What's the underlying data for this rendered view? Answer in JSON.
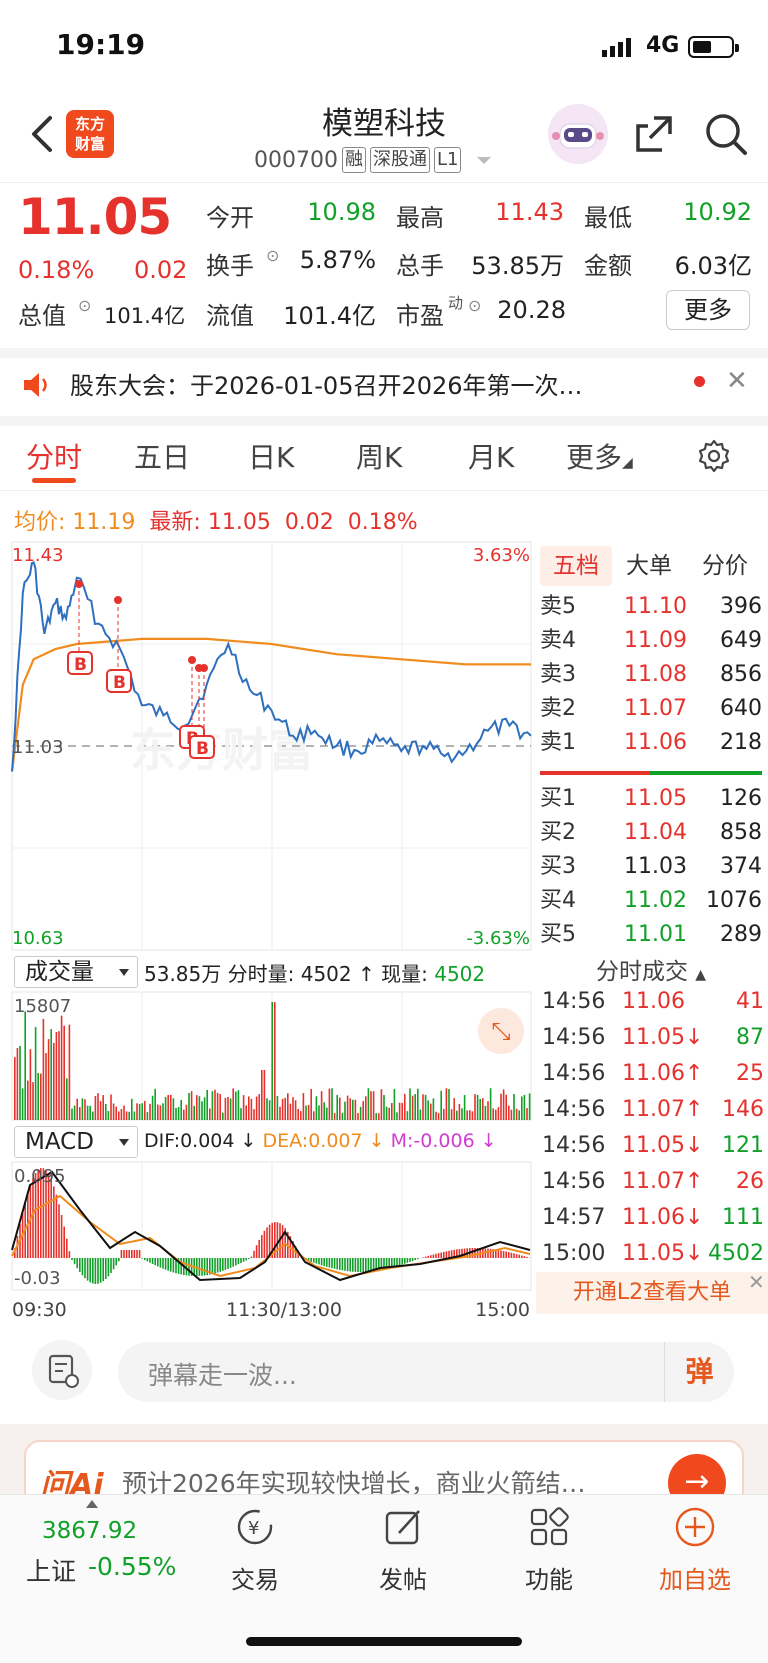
{
  "status_bar": {
    "time": "19:19",
    "network": "4G"
  },
  "header": {
    "stock_name": "模塑科技",
    "stock_code": "000700",
    "tags": [
      "融",
      "深股通",
      "L1"
    ],
    "logo_text": [
      "东方",
      "财富"
    ]
  },
  "quote": {
    "last_price": "11.05",
    "change_pct": "0.18%",
    "change_amt": "0.02",
    "open_label": "今开",
    "open": "10.98",
    "high_label": "最高",
    "high": "11.43",
    "low_label": "最低",
    "low": "10.92",
    "turnover_label": "换手",
    "turnover": "5.87%",
    "volume_label": "总手",
    "volume": "53.85万",
    "amount_label": "金额",
    "amount": "6.03亿",
    "mktcap_label": "总值",
    "mktcap": "101.4亿",
    "float_label": "流值",
    "float": "101.4亿",
    "pe_label": "市盈",
    "pe_sup": "动",
    "pe": "20.28",
    "more_label": "更多"
  },
  "announcement": {
    "text": "股东大会：于2026-01-05召开2026年第一次…"
  },
  "tabs": [
    "分时",
    "五日",
    "日K",
    "周K",
    "月K",
    "更多"
  ],
  "avg_line": {
    "avg_label": "均价:",
    "avg": "11.19",
    "latest_label": "最新:",
    "latest": "11.05",
    "chg": "0.02",
    "pct": "0.18%"
  },
  "chart_axes": {
    "y_top": "11.43",
    "y_bottom": "10.63",
    "y_mid": "11.03",
    "pct_top": "3.63%",
    "pct_bottom": "-3.63%",
    "x_start": "09:30",
    "x_mid": "11:30/13:00",
    "x_end": "15:00",
    "vol_max": "15807",
    "macd_top": "0.095",
    "macd_bottom": "-0.03",
    "trade_marker": "B",
    "watermark": "东方财富"
  },
  "chart_data": {
    "type": "line",
    "title": "",
    "xlabel": "",
    "ylabel": "",
    "ylim": [
      10.63,
      11.43
    ],
    "series": [
      {
        "name": "最新",
        "x": [
          "09:30",
          "09:35",
          "09:40",
          "09:45",
          "09:50",
          "09:55",
          "10:00",
          "10:10",
          "10:20",
          "10:30",
          "10:40",
          "10:50",
          "11:00",
          "11:10",
          "11:20",
          "11:30",
          "13:10",
          "13:20",
          "13:30",
          "13:40",
          "13:50",
          "14:00",
          "14:10",
          "14:20",
          "14:30",
          "14:40",
          "14:50",
          "15:00"
        ],
        "values": [
          10.98,
          11.33,
          11.39,
          11.25,
          11.31,
          11.28,
          11.36,
          11.27,
          11.22,
          11.11,
          11.09,
          11.07,
          11.15,
          11.23,
          11.14,
          11.1,
          11.05,
          11.06,
          11.03,
          11.02,
          11.04,
          11.02,
          11.03,
          11.01,
          11.02,
          11.06,
          11.07,
          11.05
        ]
      },
      {
        "name": "均价",
        "x": [
          "09:30",
          "09:35",
          "09:40",
          "09:50",
          "10:00",
          "10:30",
          "11:00",
          "11:30",
          "13:30",
          "14:00",
          "14:30",
          "15:00"
        ],
        "values": [
          10.98,
          11.15,
          11.2,
          11.22,
          11.23,
          11.24,
          11.24,
          11.23,
          11.21,
          11.2,
          11.19,
          11.19
        ]
      }
    ]
  },
  "volume": {
    "selector": "成交量",
    "total": "53.85万",
    "tick_label": "分时量:",
    "tick_value": "4502",
    "tick_arrow": "↑",
    "now_label": "现量:",
    "now_value": "4502"
  },
  "macd": {
    "selector": "MACD",
    "dif": "DIF:0.004 ↓",
    "dea": "DEA:0.007 ↓",
    "m": "M:-0.006 ↓"
  },
  "orderbook": {
    "tabs": [
      "五档",
      "大单",
      "分价"
    ],
    "asks": [
      {
        "label": "卖5",
        "price": "11.10",
        "vol": "396",
        "color": "red"
      },
      {
        "label": "卖4",
        "price": "11.09",
        "vol": "649",
        "color": "red"
      },
      {
        "label": "卖3",
        "price": "11.08",
        "vol": "856",
        "color": "red"
      },
      {
        "label": "卖2",
        "price": "11.07",
        "vol": "640",
        "color": "red"
      },
      {
        "label": "卖1",
        "price": "11.06",
        "vol": "218",
        "color": "red"
      }
    ],
    "bids": [
      {
        "label": "买1",
        "price": "11.05",
        "vol": "126",
        "color": "red"
      },
      {
        "label": "买2",
        "price": "11.04",
        "vol": "858",
        "color": "red"
      },
      {
        "label": "买3",
        "price": "11.03",
        "vol": "374",
        "color": "black"
      },
      {
        "label": "买4",
        "price": "11.02",
        "vol": "1076",
        "color": "green"
      },
      {
        "label": "买5",
        "price": "11.01",
        "vol": "289",
        "color": "green"
      }
    ]
  },
  "ticks": {
    "header": "分时成交",
    "rows": [
      {
        "time": "14:56",
        "price": "11.06",
        "vol": "41",
        "pc": "red",
        "vc": "red"
      },
      {
        "time": "14:56",
        "price": "11.05↓",
        "vol": "87",
        "pc": "red",
        "vc": "green"
      },
      {
        "time": "14:56",
        "price": "11.06↑",
        "vol": "25",
        "pc": "red",
        "vc": "red"
      },
      {
        "time": "14:56",
        "price": "11.07↑",
        "vol": "146",
        "pc": "red",
        "vc": "red"
      },
      {
        "time": "14:56",
        "price": "11.05↓",
        "vol": "121",
        "pc": "red",
        "vc": "green"
      },
      {
        "time": "14:56",
        "price": "11.07↑",
        "vol": "26",
        "pc": "red",
        "vc": "red"
      },
      {
        "time": "14:57",
        "price": "11.06↓",
        "vol": "111",
        "pc": "red",
        "vc": "green"
      },
      {
        "time": "15:00",
        "price": "11.05↓",
        "vol": "4502",
        "pc": "red",
        "vc": "green"
      }
    ],
    "l2_banner": "开通L2查看大单"
  },
  "danmaku": {
    "placeholder": "弹幕走一波...",
    "send": "弹"
  },
  "ai_banner": {
    "logo": "问Ai",
    "text": "预计2026年实现较快增长，商业火箭结…"
  },
  "bottom_nav": {
    "index_value": "3867.92",
    "index_name": "上证",
    "index_change": "-0.55%",
    "items": [
      "交易",
      "发帖",
      "功能",
      "加自选"
    ]
  },
  "colors": {
    "up": "#e5322d",
    "down": "#11a028",
    "accent": "#f0491e",
    "avg": "#f08c1e",
    "price_line": "#2e6fbf"
  }
}
